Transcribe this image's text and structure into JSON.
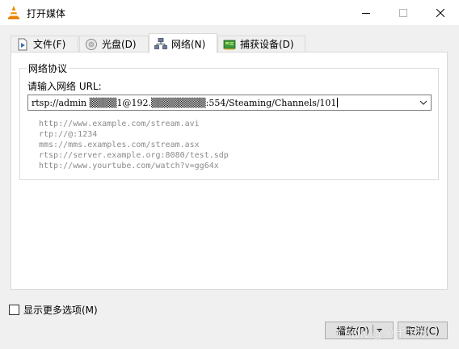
{
  "window": {
    "title": "打开媒体",
    "app_icon": "vlc-cone-icon",
    "controls": [
      "minimize-icon",
      "maximize-icon",
      "close-icon"
    ]
  },
  "tabs": [
    {
      "label": "文件(F)",
      "icon": "file-play-icon",
      "active": false
    },
    {
      "label": "光盘(D)",
      "icon": "disc-icon",
      "active": false
    },
    {
      "label": "网络(N)",
      "icon": "network-icon",
      "active": true
    },
    {
      "label": "捕获设备(D)",
      "icon": "capture-card-icon",
      "active": false
    }
  ],
  "network": {
    "group_title": "网络协议",
    "url_label": "请输入网络 URL:",
    "url_value": "rtsp://admin ▒▒▒▒1@192.▒▒▒▒▒▒▒▒:554/Steaming/Channels/101",
    "examples": [
      "http://www.example.com/stream.avi",
      "rtp://@:1234",
      "mms://mms.examples.com/stream.asx",
      "rtsp://server.example.org:8080/test.sdp",
      "http://www.yourtube.com/watch?v=gg64x"
    ]
  },
  "options": {
    "more_options_label": "显示更多选项(M)",
    "checked": false
  },
  "buttons": {
    "play_label": "播放(P)",
    "cancel_label": "取消(C)"
  },
  "watermark": "CSDN @单手下龙",
  "colors": {
    "vlc_orange": "#f08c00",
    "example_text": "#8a8a8a"
  }
}
